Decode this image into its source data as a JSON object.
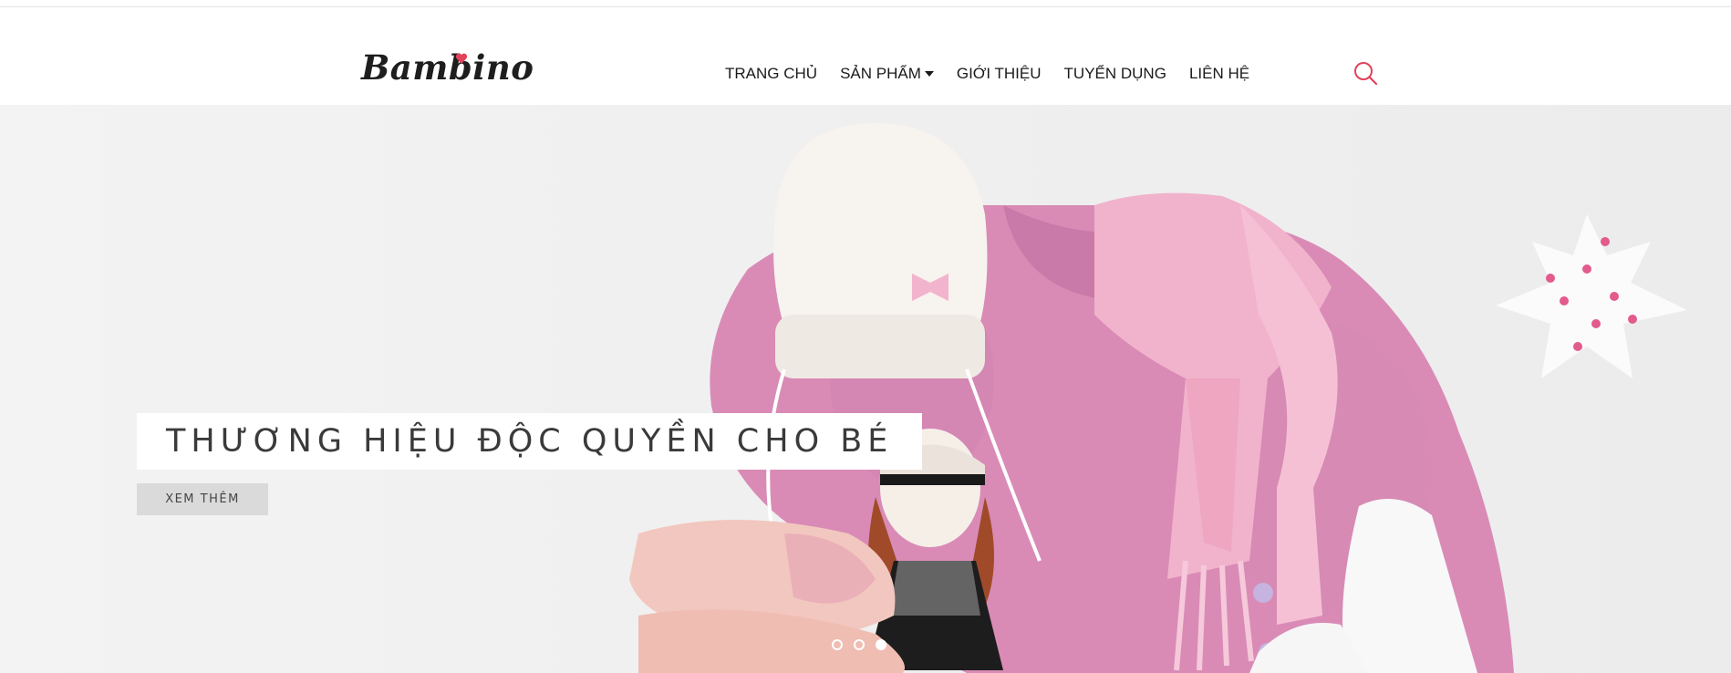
{
  "header": {
    "logo": "Bambino",
    "nav": [
      {
        "label": "TRANG CHỦ"
      },
      {
        "label": "SẢN PHẨM",
        "dropdown": true
      },
      {
        "label": "GIỚI THIỆU"
      },
      {
        "label": "TUYỂN DỤNG"
      },
      {
        "label": "LIÊN HỆ"
      }
    ],
    "search_icon": "search-icon"
  },
  "hero": {
    "title": "THƯƠNG HIỆU ĐỘC QUYỀN CHO BÉ",
    "button_label": "XEM THÊM",
    "slides": 3,
    "active_slide": 3
  },
  "colors": {
    "accent": "#e2435a",
    "pink_coat": "#d98bb6",
    "scarf": "#f1b3cb",
    "nav_text": "#1a1a1a"
  }
}
